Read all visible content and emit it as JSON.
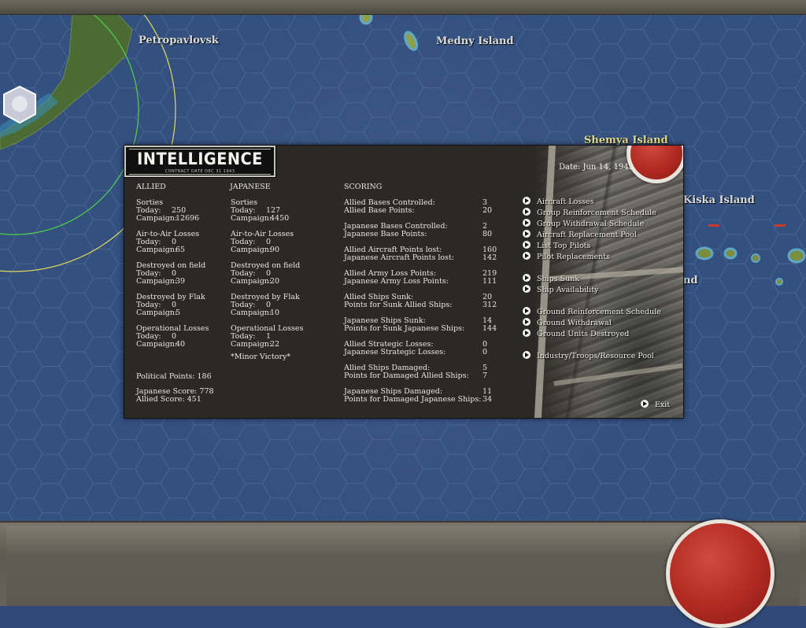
{
  "map": {
    "labels": {
      "petropavlovsk": "Petropavlovsk",
      "medny": "Medny Island",
      "shemya": "Shemya Island",
      "kiska": "Kiska Island",
      "partial_nd": "nd"
    }
  },
  "panel": {
    "title": "INTELLIGENCE",
    "subtitle": "CONTRACT DATE DEC 31 1943",
    "date": "Date: Jun 14, 1943",
    "allied": {
      "header": "ALLIED",
      "sorties": {
        "title": "Sorties",
        "today_label": "Today:",
        "today": "250",
        "campaign_label": "Campaign:",
        "campaign": "12696"
      },
      "air_to_air": {
        "title": "Air-to-Air Losses",
        "today_label": "Today:",
        "today": "0",
        "campaign_label": "Campaign:",
        "campaign": "65"
      },
      "destroyed_field": {
        "title": "Destroyed on field",
        "today_label": "Today:",
        "today": "0",
        "campaign_label": "Campaign:",
        "campaign": "39"
      },
      "destroyed_flak": {
        "title": "Destroyed by Flak",
        "today_label": "Today:",
        "today": "0",
        "campaign_label": "Campaign:",
        "campaign": "5"
      },
      "operational": {
        "title": "Operational Losses",
        "today_label": "Today:",
        "today": "0",
        "campaign_label": "Campaign:",
        "campaign": "40"
      },
      "political_points": "Political Points: 186",
      "japanese_score": "Japanese Score: 778",
      "allied_score": "Allied Score: 451"
    },
    "japanese": {
      "header": "JAPANESE",
      "sorties": {
        "title": "Sorties",
        "today_label": "Today:",
        "today": "127",
        "campaign_label": "Campaign:",
        "campaign": "4450"
      },
      "air_to_air": {
        "title": "Air-to-Air Losses",
        "today_label": "Today:",
        "today": "0",
        "campaign_label": "Campaign:",
        "campaign": "90"
      },
      "destroyed_field": {
        "title": "Destroyed on field",
        "today_label": "Today:",
        "today": "0",
        "campaign_label": "Campaign:",
        "campaign": "20"
      },
      "destroyed_flak": {
        "title": "Destroyed by Flak",
        "today_label": "Today:",
        "today": "0",
        "campaign_label": "Campaign:",
        "campaign": "10"
      },
      "operational": {
        "title": "Operational Losses",
        "today_label": "Today:",
        "today": "1",
        "campaign_label": "Campaign:",
        "campaign": "22"
      },
      "victory": "*Minor Victory*"
    },
    "scoring": {
      "header": "SCORING",
      "rows": [
        {
          "label": "Allied Bases Controlled:",
          "value": "3"
        },
        {
          "label": "Allied Base Points:",
          "value": "20"
        },
        {
          "label": "Japanese Bases Controlled:",
          "value": "2"
        },
        {
          "label": "Japanese Base Points:",
          "value": "80"
        },
        {
          "label": "Allied Aircraft Points lost:",
          "value": "160"
        },
        {
          "label": "Japanese Aircraft Points lost:",
          "value": "142"
        },
        {
          "label": "Allied Army Loss Points:",
          "value": "219"
        },
        {
          "label": "Japanese Army Loss Points:",
          "value": "111"
        },
        {
          "label": "Allied Ships Sunk:",
          "value": "20"
        },
        {
          "label": "Points for Sunk Allied Ships:",
          "value": "312"
        },
        {
          "label": "Japanese Ships Sunk:",
          "value": "14"
        },
        {
          "label": "Points for Sunk Japanese Ships:",
          "value": "144"
        },
        {
          "label": "Allied Strategic Losses:",
          "value": "0"
        },
        {
          "label": "Japanese Strategic Losses:",
          "value": "0"
        },
        {
          "label": "Allied Ships Damaged:",
          "value": "5"
        },
        {
          "label": "Points for Damaged Allied Ships:",
          "value": "7"
        },
        {
          "label": "Japanese Ships Damaged:",
          "value": "11"
        },
        {
          "label": "Points for Damaged Japanese Ships:",
          "value": "34"
        }
      ]
    },
    "menu": [
      "Aircraft Losses",
      "Group Reinforcement Schedule",
      "Group Withdrawal Schedule",
      "Aircraft Replacement Pool",
      "List Top Pilots",
      "Pilot Replacements",
      "Ships Sunk",
      "Ship Availability",
      "Ground Reinforcement Schedule",
      "Ground Withdrawal",
      "Ground Units Destroyed",
      "Industry/Troops/Resource Pool"
    ],
    "exit_label": "Exit"
  },
  "colors": {
    "ocean": "#34507f",
    "hex_line": "#4a6594",
    "panel_bg": "#2b2925",
    "land": "#4b6a34",
    "range_green": "#4fd24a",
    "range_yellow": "#e0dc59",
    "roundel_red": "#b02a22"
  }
}
